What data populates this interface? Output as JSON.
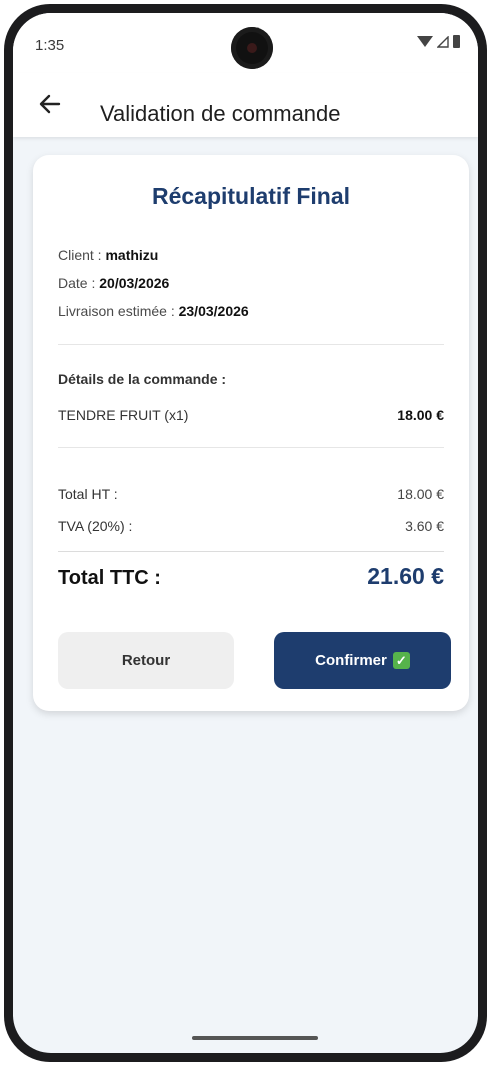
{
  "status_bar": {
    "time": "1:35"
  },
  "app_bar": {
    "title": "Validation de commande"
  },
  "summary": {
    "title": "Récapitulatif Final",
    "client_label": "Client : ",
    "client_value": "mathizu",
    "date_label": "Date : ",
    "date_value": "20/03/2026",
    "delivery_label": "Livraison estimée : ",
    "delivery_value": "23/03/2026",
    "details_title": "Détails de la commande :",
    "items": [
      {
        "name": "TENDRE FRUIT (x1)",
        "price": "18.00 €"
      }
    ],
    "total_ht_label": "Total HT :",
    "total_ht_value": "18.00 €",
    "tva_label": "TVA (20%) :",
    "tva_value": "3.60 €",
    "total_ttc_label": "Total TTC :",
    "total_ttc_value": "21.60 €"
  },
  "buttons": {
    "back_label": "Retour",
    "confirm_label": "Confirmer"
  },
  "colors": {
    "accent": "#1e3d6e",
    "background": "#f1f5f9",
    "check_green": "#56b34b"
  },
  "icons": [
    "back-arrow-icon",
    "wifi-icon",
    "signal-icon",
    "battery-icon",
    "check-mark-icon"
  ]
}
